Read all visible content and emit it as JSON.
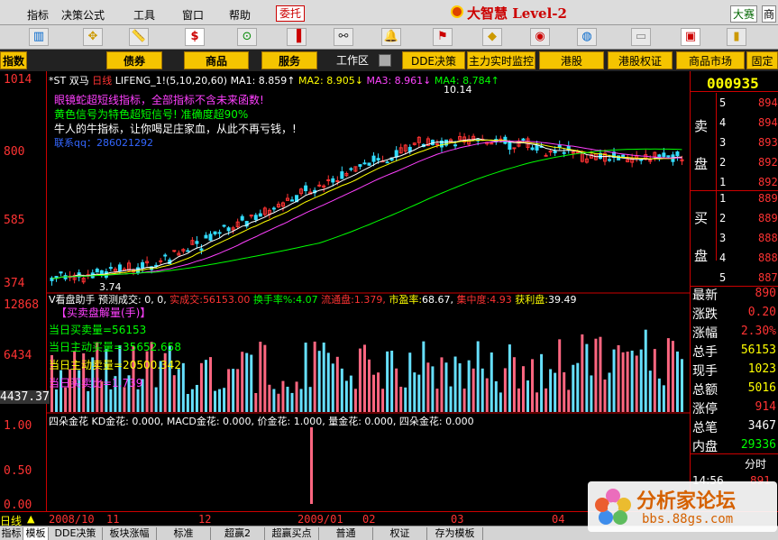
{
  "menu": {
    "items": [
      "指标",
      "决策",
      "公式",
      "工具",
      "窗口",
      "帮助"
    ],
    "commission": "委托",
    "brand": "大智慧 Level-2",
    "contest": "大赛",
    "market": "商"
  },
  "tabs": {
    "primary": [
      "指数",
      "债券",
      "商品",
      "服务"
    ],
    "workarea": "工作区",
    "secondary": [
      "DDE决策",
      "主力实时监控",
      "港股",
      "港股权证",
      "商品市场",
      "固定收"
    ]
  },
  "chart": {
    "title_line": "*ST 双马 日线 LIFENG_1!(5,10,20,60) MA1: 8.859↑ MA2: 8.905↓ MA3: 8.961↓ MA4: 8.784↑",
    "title": "*ST 双马",
    "period": "日线",
    "indicator": "LIFENG_1!(5,10,20,60)",
    "ma": [
      {
        "name": "MA1",
        "value": "8.859↑",
        "color": "#ffffff"
      },
      {
        "name": "MA2",
        "value": "8.905↓",
        "color": "#ffff00"
      },
      {
        "name": "MA3",
        "value": "8.961↓",
        "color": "#ff40ff"
      },
      {
        "name": "MA4",
        "value": "8.784↑",
        "color": "#00ff00"
      }
    ],
    "notes": [
      {
        "text": "眼镜蛇超短线指标，全部指标不含未来函数!",
        "color": "#ff40ff"
      },
      {
        "text": "黄色信号为特色超短信号! 准确度超90%",
        "color": "#00ff00"
      },
      {
        "text": "牛人的牛指标，让你喝足庄家血，从此不再亏钱，!",
        "color": "#ffffff"
      },
      {
        "text": "联系qq：286021292",
        "color": "#3366ff"
      }
    ],
    "y_ticks_main": [
      "1014",
      "800",
      "585",
      "374"
    ],
    "high_label": "10.14",
    "low_label": "3.74",
    "vol_header": {
      "label": "V看盘助手 预测成交: 0, 0,",
      "fields": [
        {
          "k": "实成交:",
          "v": "56153.00",
          "color": "#ff3333"
        },
        {
          "k": "换手率%:",
          "v": "4.07",
          "color": "#00ff00"
        },
        {
          "k": "流通盘:",
          "v": "1.379,",
          "color": "#ff3333"
        },
        {
          "k": "市盈率:",
          "v": "68.67,",
          "color": "#ffffff"
        },
        {
          "k": "集中度:",
          "v": "4.93",
          "color": "#ff3333"
        },
        {
          "k": "获利盘:",
          "v": "39.49",
          "color": "#ffffff"
        }
      ]
    },
    "vol_notes": [
      {
        "text": "【买卖盘解量(手)】",
        "color": "#ff40ff"
      },
      {
        "text": "当日买卖量=56153",
        "color": "#00ff00"
      },
      {
        "text": "当日主动买量=35652.658",
        "color": "#00ff00"
      },
      {
        "text": "当日主动卖量=20500.342",
        "color": "#ffff00"
      },
      {
        "text": "当日买卖比=1.739",
        "color": "#ff40ff"
      }
    ],
    "y_ticks_vol": [
      "12868",
      "6434",
      "4437.37"
    ],
    "gold_line": "四朵金花 KD金花: 0.000, MACD金花: 0.000, 价金花: 1.000, 量金花: 0.000, 四朵金花: 0.000",
    "y_ticks_gold": [
      "1.00",
      "0.50",
      "0.00"
    ],
    "dates": [
      "日线",
      "2008/10",
      "11",
      "12",
      "2009/01",
      "02",
      "03",
      "04"
    ]
  },
  "quote": {
    "code": "000935",
    "sell_label": [
      "卖",
      "盘"
    ],
    "buy_label": [
      "买",
      "盘"
    ],
    "sell_levels": [
      "5",
      "4",
      "3",
      "2",
      "1"
    ],
    "sell_prices": [
      "894",
      "894",
      "893",
      "892",
      "892"
    ],
    "buy_levels": [
      "1",
      "2",
      "3",
      "4",
      "5"
    ],
    "buy_prices": [
      "889",
      "889",
      "888",
      "888",
      "887"
    ],
    "stats": [
      {
        "k": "最新",
        "v": "890",
        "color": "#ff3333"
      },
      {
        "k": "涨跌",
        "v": "0.20",
        "color": "#ff3333"
      },
      {
        "k": "涨幅",
        "v": "2.30%",
        "color": "#ff3333"
      },
      {
        "k": "总手",
        "v": "56153",
        "color": "#ffff00"
      },
      {
        "k": "现手",
        "v": "1023",
        "color": "#ffff00"
      },
      {
        "k": "总额",
        "v": "5016",
        "color": "#ffff00"
      },
      {
        "k": "涨停",
        "v": "914",
        "color": "#ff3333"
      },
      {
        "k": "总笔",
        "v": "3467",
        "color": "#ffffff"
      },
      {
        "k": "内盘",
        "v": "29336",
        "color": "#00ff00"
      }
    ],
    "fenshi": "分时",
    "time": "14:56",
    "time_price": "891"
  },
  "bottom_tabs": [
    "指标",
    "模板",
    "DDE决策",
    "板块涨幅",
    "标准",
    "超赢2",
    "超赢买点",
    "普通",
    "权证",
    "存为模板"
  ],
  "watermark": {
    "title": "分析家论坛",
    "url": "bbs.88gs.com"
  }
}
